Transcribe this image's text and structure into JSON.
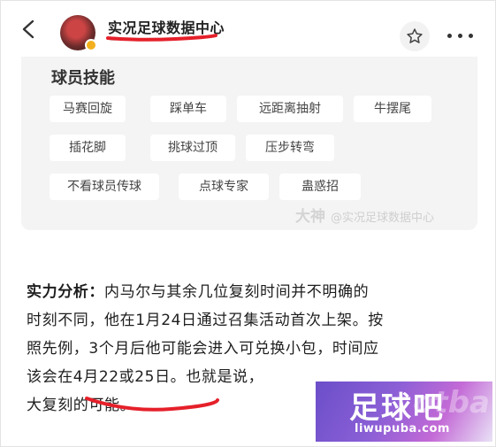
{
  "header": {
    "account_name": "实况足球数据中心",
    "back_icon": "chevron-left-icon",
    "star_icon": "star-icon",
    "more_icon": "more-dots-icon"
  },
  "skills_card": {
    "title": "球员技能",
    "skills": [
      "马赛回旋",
      "踩单车",
      "远距离抽射",
      "牛摆尾",
      "插花脚",
      "挑球过顶",
      "压步转弯",
      "不看球员传球",
      "点球专家",
      "蛊惑招"
    ],
    "watermark_brand": "大神",
    "watermark_text": "@实况足球数据中心"
  },
  "article": {
    "label": "实力分析：",
    "line1": "内马尔与其余几位复刻时间并不明确的",
    "line2": "时刻不同，他在1月24日通过召集活动首次上架。按",
    "line3": "照先例，3个月后他可能会进入可兑换小包，时间应",
    "line4": "该会在4月22或25日。也就是说，",
    "line5": "大复刻的可能。"
  },
  "logo": {
    "main": "足球吧",
    "bg": "otba",
    "url": "liwupuba.com"
  },
  "colors": {
    "underline": "#e5202a",
    "card_bg": "#f4f4f4",
    "avatar_badge": "#f2b01e"
  }
}
